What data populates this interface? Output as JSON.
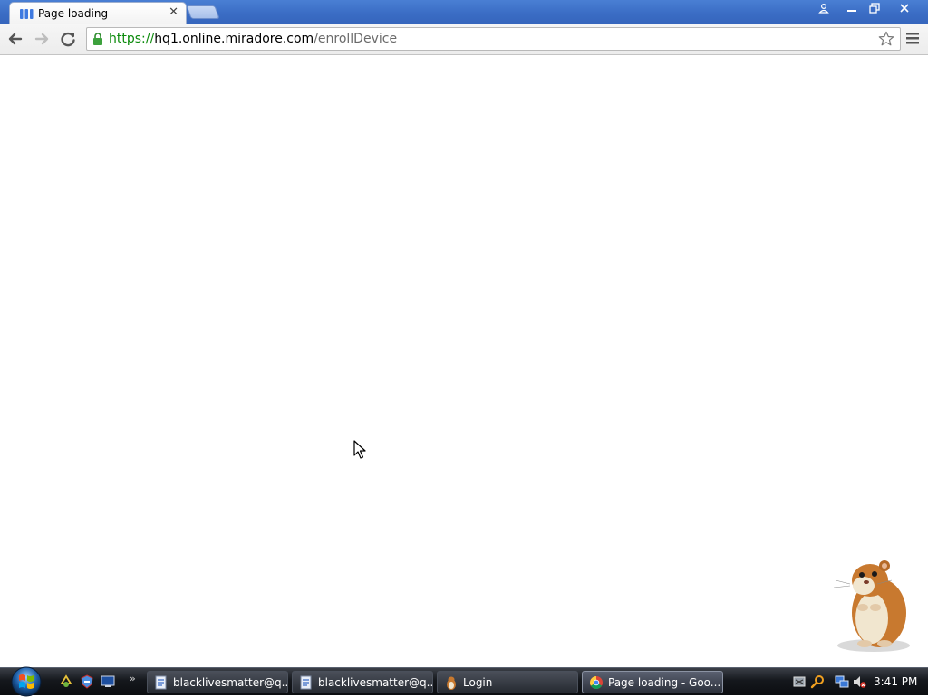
{
  "browser": {
    "tab": {
      "title": "Page loading",
      "close_glyph": "✕",
      "favicon": "loading-bars-icon"
    },
    "new_tab": "new-tab-button",
    "window_controls": {
      "profile": "person-icon",
      "minimize": "minimize-icon",
      "maximize": "restore-icon",
      "close": "close-icon"
    },
    "toolbar": {
      "back": "back-arrow-icon",
      "forward": "forward-arrow-icon",
      "reload": "reload-icon",
      "menu": "menu-icon"
    },
    "omnibox": {
      "scheme": "https://",
      "host": "hq1.online.miradore.com",
      "path": "/enrollDevice",
      "lock": "lock-icon",
      "star": "star-icon"
    }
  },
  "taskbar": {
    "start": "windows-start-orb",
    "quick_launch_more": "»",
    "tasks": [
      {
        "label": "blacklivesmatter@q...",
        "icon": "document-icon",
        "active": false
      },
      {
        "label": "blacklivesmatter@q...",
        "icon": "document-icon",
        "active": false
      },
      {
        "label": "Login",
        "icon": "hamster-icon",
        "active": false
      },
      {
        "label": "Page loading - Goo...",
        "icon": "chrome-icon",
        "active": true
      }
    ],
    "tray": {
      "clock": "3:41 PM"
    }
  },
  "colors": {
    "titlebar": "#3a6cc4",
    "url_scheme": "#0a8a0a",
    "url_path": "#6a6a6a",
    "taskbar": "#15181d"
  }
}
